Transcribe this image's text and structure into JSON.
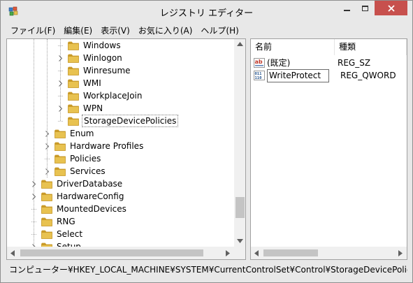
{
  "window": {
    "title": "レジストリ エディター"
  },
  "menu": [
    "ファイル(F)",
    "編集(E)",
    "表示(V)",
    "お気に入り(A)",
    "ヘルプ(H)"
  ],
  "tree": {
    "items": [
      {
        "label": "Windows",
        "expander": false,
        "level": 3,
        "selected": false
      },
      {
        "label": "Winlogon",
        "expander": true,
        "level": 3,
        "selected": false
      },
      {
        "label": "Winresume",
        "expander": false,
        "level": 3,
        "selected": false
      },
      {
        "label": "WMI",
        "expander": true,
        "level": 3,
        "selected": false
      },
      {
        "label": "WorkplaceJoin",
        "expander": false,
        "level": 3,
        "selected": false
      },
      {
        "label": "WPN",
        "expander": true,
        "level": 3,
        "selected": false
      },
      {
        "label": "StorageDevicePolicies",
        "expander": false,
        "level": 3,
        "selected": true
      },
      {
        "label": "Enum",
        "expander": true,
        "level": 2,
        "selected": false
      },
      {
        "label": "Hardware Profiles",
        "expander": true,
        "level": 2,
        "selected": false
      },
      {
        "label": "Policies",
        "expander": false,
        "level": 2,
        "selected": false
      },
      {
        "label": "Services",
        "expander": true,
        "level": 2,
        "selected": false
      },
      {
        "label": "DriverDatabase",
        "expander": true,
        "level": 1,
        "selected": false
      },
      {
        "label": "HardwareConfig",
        "expander": true,
        "level": 1,
        "selected": false
      },
      {
        "label": "MountedDevices",
        "expander": false,
        "level": 1,
        "selected": false
      },
      {
        "label": "RNG",
        "expander": false,
        "level": 1,
        "selected": false
      },
      {
        "label": "Select",
        "expander": false,
        "level": 1,
        "selected": false
      },
      {
        "label": "Setup",
        "expander": true,
        "level": 1,
        "selected": false
      }
    ]
  },
  "list": {
    "headers": {
      "name": "名前",
      "type": "種類"
    },
    "rows": [
      {
        "name": "(既定)",
        "type": "REG_SZ",
        "icon": "string-value-icon",
        "editing": false
      },
      {
        "name": "WriteProtect",
        "type": "REG_QWORD",
        "icon": "binary-value-icon",
        "editing": true
      }
    ]
  },
  "status": {
    "path": "コンピューター¥HKEY_LOCAL_MACHINE¥SYSTEM¥CurrentControlSet¥Control¥StorageDevicePolicies"
  },
  "colors": {
    "close": "#c7504d",
    "folder": "#e8c250",
    "folder_dark": "#c99a28"
  }
}
